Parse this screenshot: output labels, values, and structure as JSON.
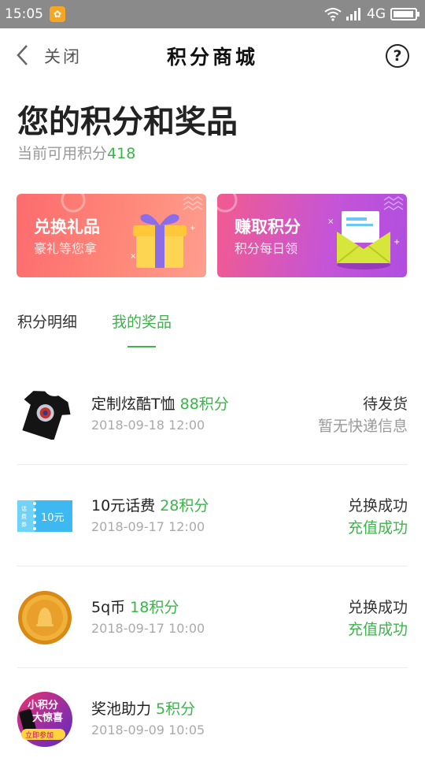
{
  "statusbar": {
    "time": "15:05",
    "network": "4G"
  },
  "nav": {
    "close": "关闭",
    "title": "积分商城",
    "help": "?"
  },
  "summary": {
    "headline": "您的积分和奖品",
    "points_label": "当前可用积分",
    "points_value": "418"
  },
  "cards": [
    {
      "title": "兑换礼品",
      "subtitle": "豪礼等您拿"
    },
    {
      "title": "赚取积分",
      "subtitle": "积分每日领"
    }
  ],
  "tabs": [
    {
      "label": "积分明细",
      "active": false
    },
    {
      "label": "我的奖品",
      "active": true
    }
  ],
  "prizes": [
    {
      "name": "定制炫酷T恤",
      "cost": "88积分",
      "date": "2018-09-18 12:00",
      "status": "待发货",
      "detail": "暂无快递信息",
      "detail_color": "gray",
      "icon": "tshirt-icon"
    },
    {
      "name": "10元话费",
      "cost": "28积分",
      "date": "2018-09-17 12:00",
      "status": "兑换成功",
      "detail": "充值成功",
      "detail_color": "green",
      "icon": "phone-credit-ticket-icon"
    },
    {
      "name": "5q币",
      "cost": "18积分",
      "date": "2018-09-17 10:00",
      "status": "兑换成功",
      "detail": "充值成功",
      "detail_color": "green",
      "icon": "gold-coin-icon"
    },
    {
      "name": "奖池助力",
      "cost": "5积分",
      "date": "2018-09-09 10:05",
      "status": "",
      "detail": "",
      "detail_color": "gray",
      "icon": "prize-pool-banner-icon"
    }
  ],
  "ticket_text": {
    "side": "话费券",
    "amount": "10元"
  },
  "promo_text": {
    "line1": "小积分",
    "line2": "大惊喜",
    "cta": "立即参加"
  },
  "colors": {
    "accent_green": "#3bb54a",
    "status_bar": "#8a8a8a"
  }
}
